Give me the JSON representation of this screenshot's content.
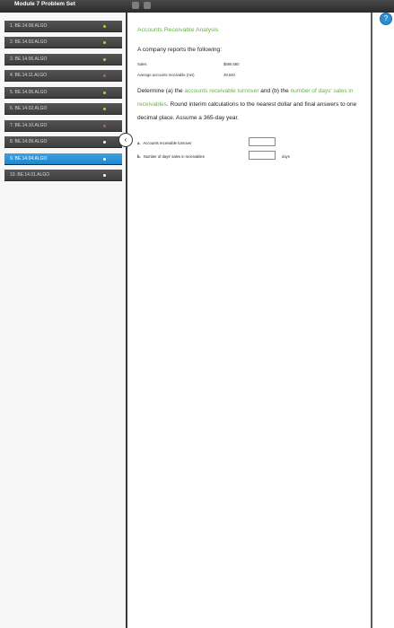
{
  "module_title": "Module 7 Problem Set",
  "problems": [
    {
      "label": "1. BE.14.08.ALGO",
      "dot_color": "#c8c83a",
      "active": false
    },
    {
      "label": "2. BE.14.03.ALGO",
      "dot_color": "#c8c83a",
      "active": false
    },
    {
      "label": "3. BE.14.06.ALGO",
      "dot_color": "#c8c83a",
      "active": false
    },
    {
      "label": "4. BE.14.11.ALGO",
      "dot_color": "#d64a8a",
      "active": false
    },
    {
      "label": "5. BE.14.05.ALGO",
      "dot_color": "#c8c83a",
      "active": false
    },
    {
      "label": "6. BE.14.02.ALGO",
      "dot_color": "#c8c83a",
      "active": false
    },
    {
      "label": "7. BE.14.10.ALGO",
      "dot_color": "#d64a8a",
      "active": false
    },
    {
      "label": "8. BE.14.09.ALGO",
      "dot_color": "#ffffff",
      "active": false
    },
    {
      "label": "9. BE.14.04.ALGO",
      "dot_color": "#ffffff",
      "active": true
    },
    {
      "label": "10. BE.14.01.ALGO",
      "dot_color": "#ffffff",
      "active": false
    }
  ],
  "collapse_icon": "chevron-left-icon",
  "help_label": "?",
  "title": "Accounts Receivable Analysis",
  "intro": "A company reports the following:",
  "table": [
    {
      "label": "Sales",
      "value": "$595,680"
    },
    {
      "label": "Average accounts receivable (net)",
      "value": "49,640"
    }
  ],
  "instruction": {
    "p1": "Determine (a) the ",
    "h1": "accounts receivable turnover",
    "p2": " and (b) the ",
    "h2": "number of days' sales in receivables",
    "p3": ". Round interim calculations to the nearest dollar and final answers to one decimal place. Assume a 365-day year."
  },
  "questions": [
    {
      "letter": "a.",
      "label": "Accounts receivable turnover",
      "value": "",
      "unit": ""
    },
    {
      "letter": "b.",
      "label": "Number of days' sales in receivables",
      "value": "",
      "unit": "days"
    }
  ],
  "colors": {
    "accent_green": "#6ab04c",
    "active_blue": "#2b8fd6",
    "nav_dark": "#444444"
  }
}
